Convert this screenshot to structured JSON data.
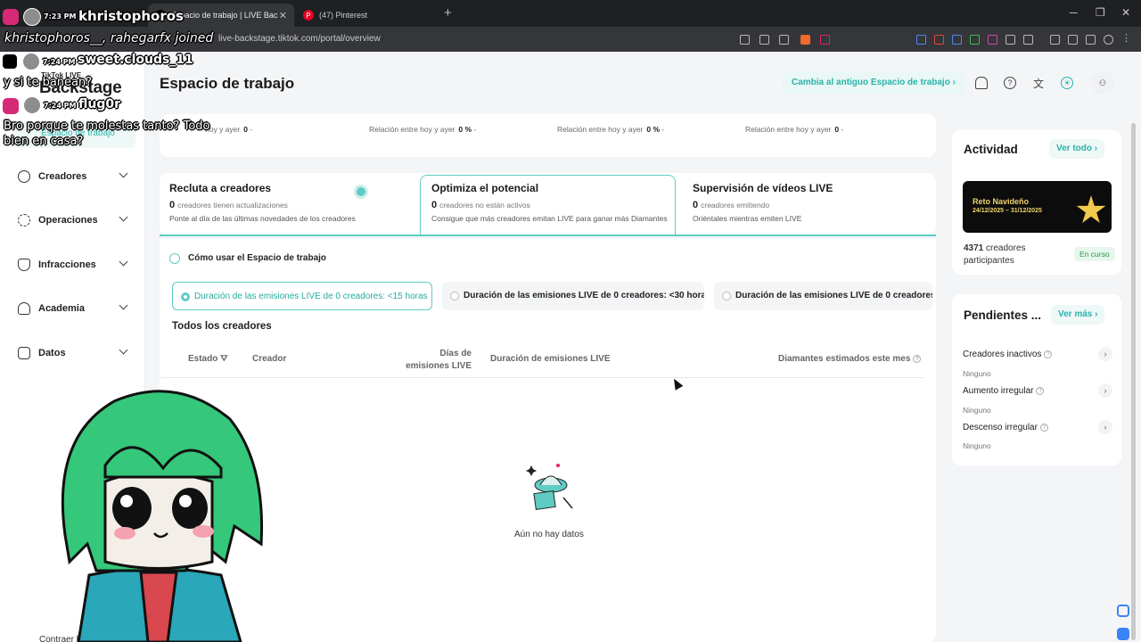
{
  "browser": {
    "tabs": [
      {
        "label": "Espacio de trabajo | LIVE Backsta"
      },
      {
        "label": "(47) Pinterest"
      }
    ],
    "url": "live-backstage.tiktok.com/portal/overview"
  },
  "sidebar": {
    "brand_small": "TikTok LIVE",
    "brand": "Backstage",
    "active_item": "Espacio de trabajo",
    "items": [
      {
        "label": "Creadores"
      },
      {
        "label": "Operaciones"
      },
      {
        "label": "Infracciones"
      },
      {
        "label": "Academia"
      },
      {
        "label": "Datos"
      }
    ],
    "footer": "Contraer barra l"
  },
  "header": {
    "title": "Espacio de trabajo",
    "old_workspace_button": "Cambia al antiguo Espacio de trabajo"
  },
  "stats_row": [
    {
      "label": "hoy y ayer",
      "value": "0",
      "delta": "-"
    },
    {
      "label": "Relación entre hoy y ayer",
      "value": "0 %",
      "delta": "-"
    },
    {
      "label": "Relación entre hoy y ayer",
      "value": "0 %",
      "delta": "-"
    },
    {
      "label": "Relación entre hoy y ayer",
      "value": "0",
      "delta": "-"
    }
  ],
  "tab_cards": [
    {
      "title": "Recluta a creadores",
      "count": "0",
      "count_text": "creadores tienen actualizaciones",
      "desc": "Ponte al día de las últimas novedades de los creadores"
    },
    {
      "title": "Optimiza el potencial",
      "count": "0",
      "count_text": "creadores no están activos",
      "desc": "Consigue que más creadores emitan LIVE para ganar más Diamantes"
    },
    {
      "title": "Supervisión de vídeos LIVE",
      "count": "0",
      "count_text": "creadores emitiendo",
      "desc": "Oriéntales mientras emiten LIVE"
    }
  ],
  "howto": "Cómo usar el Espacio de trabajo",
  "filters": [
    {
      "label": "Duración de las emisiones LIVE de 0 creadores: <15 horas",
      "selected": true
    },
    {
      "label": "Duración de las emisiones LIVE de 0 creadores: <30 horas",
      "selected": false
    },
    {
      "label": "Duración de las emisiones LIVE de 0 creadores",
      "selected": false
    }
  ],
  "table": {
    "title": "Todos los creadores",
    "columns": {
      "estado": "Estado",
      "creador": "Creador",
      "dias_1": "Días de",
      "dias_2": "emisiones LIVE",
      "duracion": "Duración de emisiones LIVE",
      "diamantes": "Diamantes estimados este mes"
    },
    "empty_text": "Aún no hay datos"
  },
  "activity": {
    "title": "Actividad",
    "view_all": "Ver todo",
    "banner_title": "Reto Navideño",
    "banner_dates": "24/12/2025 – 31/12/2025",
    "participants_count": "4371",
    "participants_label": "creadores",
    "participants_label_2": "participantes",
    "status": "En curso"
  },
  "pending": {
    "title": "Pendientes ...",
    "view_more": "Ver más",
    "items": [
      {
        "label": "Creadores inactivos",
        "value": "Ninguno"
      },
      {
        "label": "Aumento irregular",
        "value": "Ninguno"
      },
      {
        "label": "Descenso irregular",
        "value": "Ninguno"
      }
    ]
  },
  "overlay": {
    "user_top": "khristophoros",
    "time_top": "7:23 PM",
    "joined": "khristophoros__, rahegarfx joined",
    "chat": [
      {
        "time": "7:24 PM",
        "user": "sweet.clouds_11",
        "msg": "y si te banean?"
      },
      {
        "time": "7:24 PM",
        "user": "flug0r",
        "msg": "Bro porque te molestas tanto? Todo"
      },
      {
        "msg": "bien en casa?"
      }
    ]
  },
  "colors": {
    "accent": "#28b6ad",
    "accent_bg": "#eef8f7"
  }
}
